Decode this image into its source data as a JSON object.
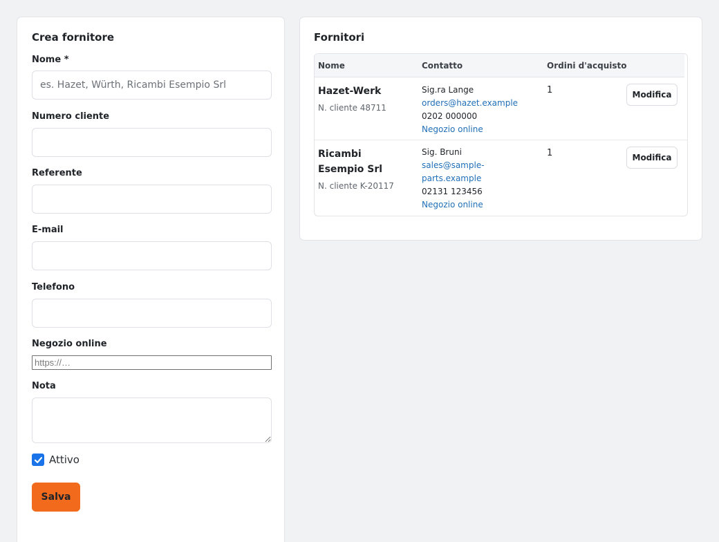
{
  "form": {
    "title": "Crea fornitore",
    "name_label": "Nome *",
    "name_placeholder": "es. Hazet, Würth, Ricambi Esempio Srl",
    "customer_number_label": "Numero cliente",
    "contact_label": "Referente",
    "email_label": "E-mail",
    "phone_label": "Telefono",
    "shop_label": "Negozio online",
    "shop_placeholder": "https://…",
    "note_label": "Nota",
    "active_label": "Attivo",
    "active_checked": true,
    "save_label": "Salva"
  },
  "list": {
    "title": "Fornitori",
    "columns": [
      "Nome",
      "Contatto",
      "Ordini d'acquisto"
    ],
    "rows": [
      {
        "name": "Hazet-Werk",
        "customer_number": "N. cliente 48711",
        "contact_person": "Sig.ra Lange",
        "email": "orders@hazet.example",
        "phone": "0202 000000",
        "shop_link": "Negozio online",
        "orders": "1",
        "edit_label": "Modifica"
      },
      {
        "name": "Ricambi Esempio Srl",
        "customer_number": "N. cliente K-20117",
        "contact_person": "Sig. Bruni",
        "email": "sales@sample-parts.example",
        "phone": "02131 123456",
        "shop_link": "Negozio online",
        "orders": "1",
        "edit_label": "Modifica"
      }
    ]
  },
  "colors": {
    "accent": "#f26a1b",
    "link": "#1f6fb8",
    "checkbox": "#1a73e8",
    "background": "#f1f2f4"
  }
}
